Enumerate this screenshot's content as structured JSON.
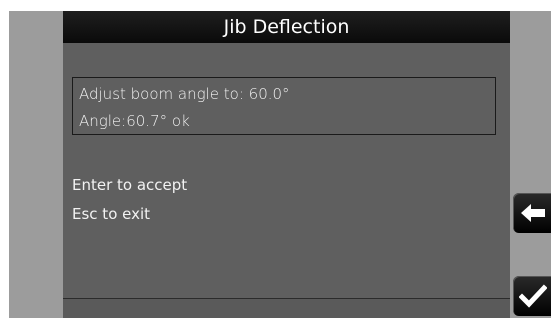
{
  "window": {
    "title": "Jib Deflection"
  },
  "info_box": {
    "target_text": "Adjust boom angle to: 60.0°",
    "status_text": "Angle:60.7° ok"
  },
  "instructions": {
    "enter_hint": "Enter to accept",
    "esc_hint": "Esc to exit"
  },
  "buttons": {
    "back_icon": "arrow-left-icon",
    "accept_icon": "checkmark-icon"
  },
  "colors": {
    "panel_bg": "#5f5f5f",
    "title_bg": "#111111",
    "side_bg": "#9c9c9c",
    "text": "#f2f2f2"
  }
}
